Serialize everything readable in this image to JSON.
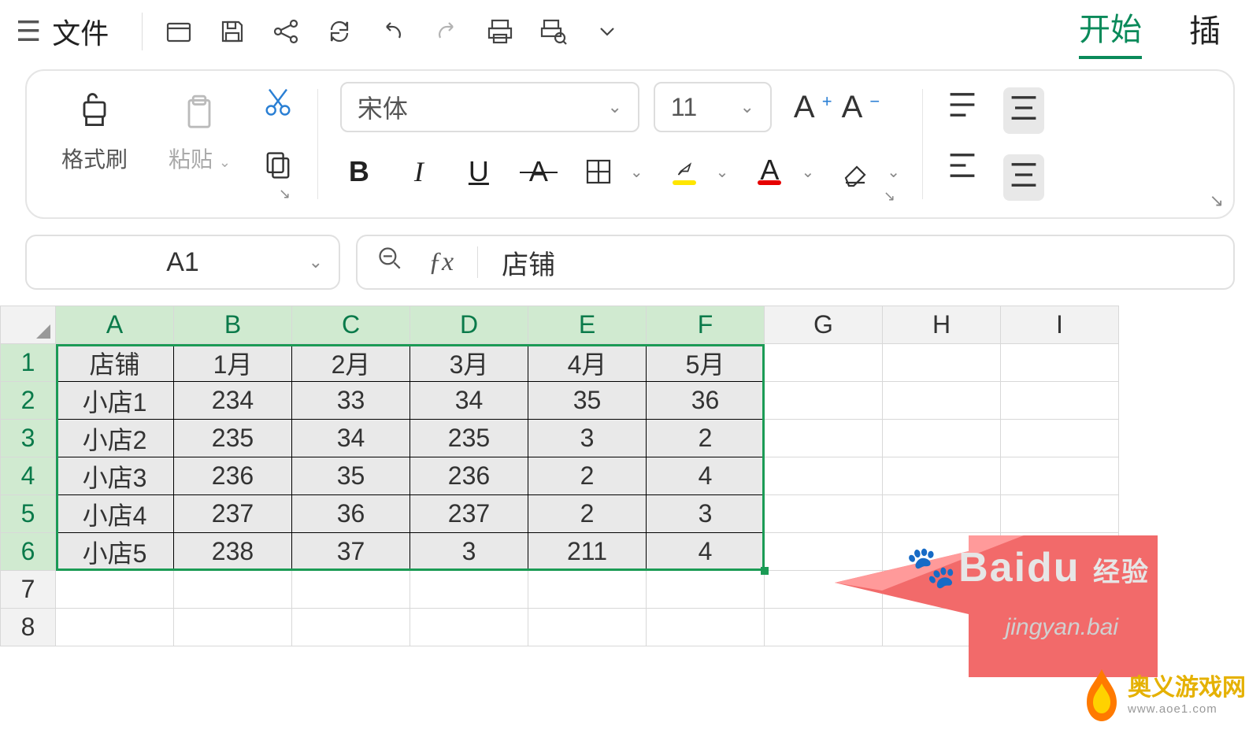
{
  "menu": {
    "file": "文件"
  },
  "tabs": {
    "start": "开始",
    "insert": "插"
  },
  "ribbon": {
    "format_painter": "格式刷",
    "paste": "粘贴",
    "font_name": "宋体",
    "font_size": "11"
  },
  "namebox": {
    "ref": "A1"
  },
  "formula": {
    "value": "店铺"
  },
  "chart_data": {
    "type": "table",
    "columns": [
      "A",
      "B",
      "C",
      "D",
      "E",
      "F",
      "G",
      "H",
      "I"
    ],
    "headers": [
      "店铺",
      "1月",
      "2月",
      "3月",
      "4月",
      "5月"
    ],
    "rows": [
      [
        "小店1",
        "234",
        "33",
        "34",
        "35",
        "36"
      ],
      [
        "小店2",
        "235",
        "34",
        "235",
        "3",
        "2"
      ],
      [
        "小店3",
        "236",
        "35",
        "236",
        "2",
        "4"
      ],
      [
        "小店4",
        "237",
        "36",
        "237",
        "2",
        "3"
      ],
      [
        "小店5",
        "238",
        "37",
        "3",
        "211",
        "4"
      ]
    ],
    "row_numbers": [
      "1",
      "2",
      "3",
      "4",
      "5",
      "6",
      "7",
      "8"
    ],
    "selection": "A1:F6"
  },
  "watermark": {
    "brand": "Baidu",
    "sub": "jingyan.bai",
    "tag": "经验"
  },
  "site": {
    "name": "奥义游戏网",
    "url": "www.aoe1.com"
  }
}
